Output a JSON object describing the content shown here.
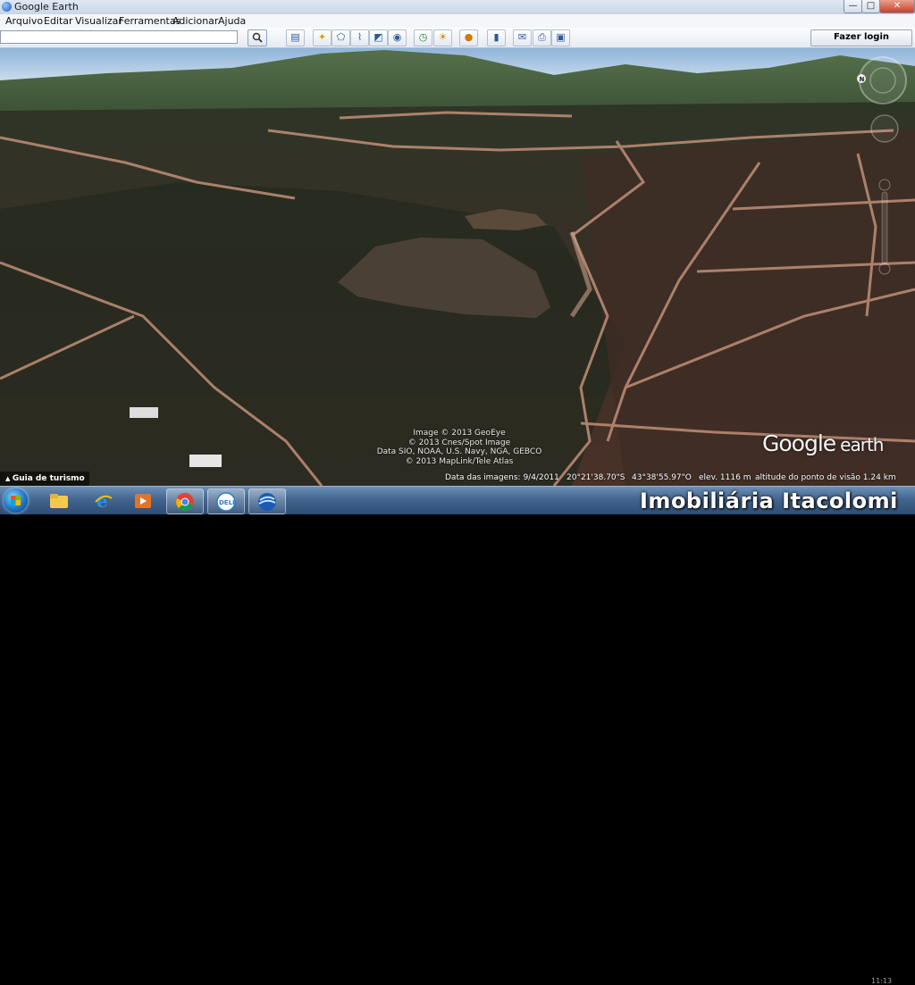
{
  "window": {
    "title": "Google Earth",
    "minimize": "—",
    "maximize": "□",
    "close": "✕"
  },
  "menu": [
    "Arquivo",
    "Editar",
    "Visualizar",
    "Ferramentas",
    "Adicionar",
    "Ajuda"
  ],
  "toolbar": {
    "search_value": "",
    "search_icon": "magnifier-icon",
    "login_label": "Fazer login"
  },
  "map": {
    "tour_label": "Guia de turismo",
    "credits": [
      "Image © 2013 GeoEye",
      "© 2013 Cnes/Spot Image",
      "Data SIO, NOAA, U.S. Navy, NGA, GEBCO",
      "© 2013 MapLink/Tele Atlas"
    ],
    "logo_main": "Google",
    "logo_sub": "earth"
  },
  "status": {
    "imagery_date": "Data das imagens: 9/4/2011",
    "lat": "20°21'38.70\"S",
    "lon": "43°38'55.97\"O",
    "elevation": "elev. 1116 m",
    "eye_alt": "altitude do ponto de visão 1.24 km"
  },
  "taskbar": {
    "watermark": "Imobiliária Itacolomi",
    "clock": "11:13"
  },
  "colors": {
    "taskbar": "#43658f",
    "titlebar": "#c9d6e6",
    "chrome_red": "#db4437",
    "ge_blue": "#1c5bb3"
  }
}
